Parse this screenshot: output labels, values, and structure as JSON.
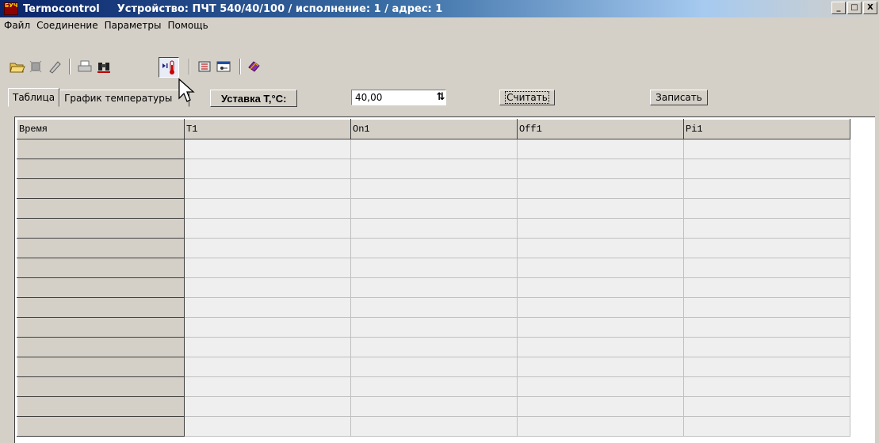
{
  "window": {
    "app_name": "Termocontrol",
    "device_info": "Устройство: ПЧТ 540/40/100 / исполнение: 1 / адрес: 1",
    "minimize": "_",
    "maximize": "□",
    "close": "X"
  },
  "menu": [
    "Файл",
    "Соединение",
    "Параметры",
    "Помощь"
  ],
  "toolbar": [
    {
      "icon": "open-folder-icon"
    },
    {
      "icon": "stop-icon"
    },
    {
      "icon": "clear-icon"
    },
    {
      "icon": "print-icon"
    },
    {
      "icon": "find-icon"
    },
    {
      "icon": "thermometer-play-icon",
      "active": true
    },
    {
      "icon": "device-settings-icon"
    },
    {
      "icon": "connect-icon"
    },
    {
      "icon": "help-icon"
    }
  ],
  "tabs": {
    "table": "Таблица",
    "chart": "График температуры"
  },
  "setpoint": {
    "label": "Уставка T,°C:",
    "value": "40,00"
  },
  "buttons": {
    "read": "Считать",
    "write": "Записать"
  },
  "grid": {
    "columns": [
      "Время",
      "T1",
      "On1",
      "Off1",
      "Pi1"
    ],
    "row_count": 15
  }
}
